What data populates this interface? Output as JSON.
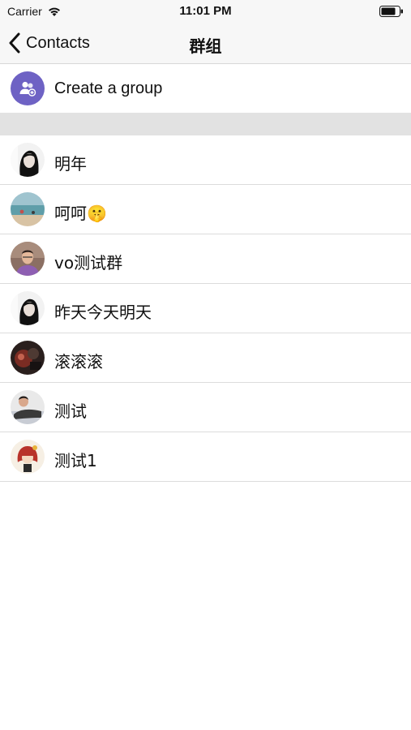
{
  "status_bar": {
    "carrier": "Carrier",
    "time": "11:01 PM"
  },
  "nav": {
    "back_label": "Contacts",
    "title": "群组"
  },
  "create_group": {
    "label": "Create a group",
    "icon": "group-add-icon",
    "icon_color": "#6e62c4"
  },
  "groups": [
    {
      "name": "明年",
      "avatar": "woman-bw-portrait"
    },
    {
      "name": "呵呵🤫",
      "avatar": "beach-photo"
    },
    {
      "name": "vo测试群",
      "avatar": "man-purple-shirt"
    },
    {
      "name": "昨天今天明天",
      "avatar": "woman-bw-portrait"
    },
    {
      "name": "滚滚滚",
      "avatar": "dark-red-photo"
    },
    {
      "name": "测试",
      "avatar": "man-lying-photo"
    },
    {
      "name": "测试1",
      "avatar": "girl-red-hair-cartoon"
    }
  ],
  "colors": {
    "nav_background": "#f7f7f7",
    "section_separator": "#e2e2e2"
  }
}
